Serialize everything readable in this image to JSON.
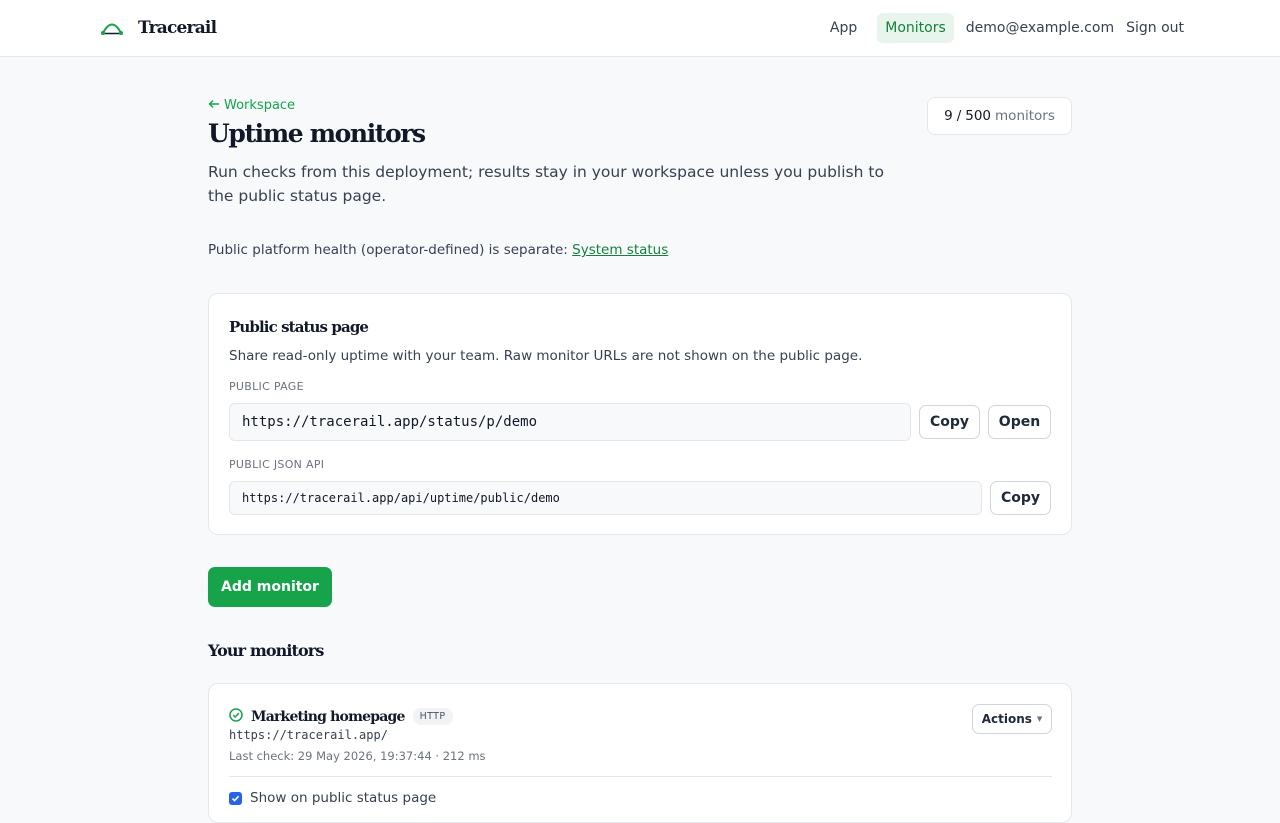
{
  "brand": {
    "name": "Tracerail",
    "accent": "#16a34a"
  },
  "nav": {
    "items": [
      {
        "label": "App",
        "active": false
      },
      {
        "label": "Monitors",
        "active": true
      }
    ],
    "user_email": "demo@example.com",
    "sign_out": "Sign out"
  },
  "page": {
    "back_label": "Workspace",
    "title": "Uptime monitors",
    "description": "Run checks from this deployment; results stay in your workspace unless you publish to the public status page.",
    "monitor_count": {
      "used": "9",
      "separator": "/",
      "limit": "500",
      "unit": "monitors"
    },
    "health_text": "Public platform health (operator-defined) is separate:",
    "health_link": "System status"
  },
  "status_card": {
    "title": "Public status page",
    "description": "Share read-only uptime with your team. Raw monitor URLs are not shown on the public page.",
    "public_page_label": "PUBLIC PAGE",
    "public_page_url": "https://tracerail.app/status/p/demo",
    "json_api_label": "PUBLIC JSON API",
    "json_api_url": "https://tracerail.app/api/uptime/public/demo",
    "copy_label": "Copy",
    "open_label": "Open"
  },
  "add_monitor_label": "Add monitor",
  "monitors_section_title": "Your monitors",
  "monitors": [
    {
      "name": "Marketing homepage",
      "type": "HTTP",
      "status": "up",
      "status_color": "#16a34a",
      "url": "https://tracerail.app/",
      "last_check": "Last check: 29 May 2026, 19:37:44 · 212 ms",
      "actions_label": "Actions",
      "public_toggle_label": "Show on public status page",
      "public_toggle_checked": true
    }
  ]
}
